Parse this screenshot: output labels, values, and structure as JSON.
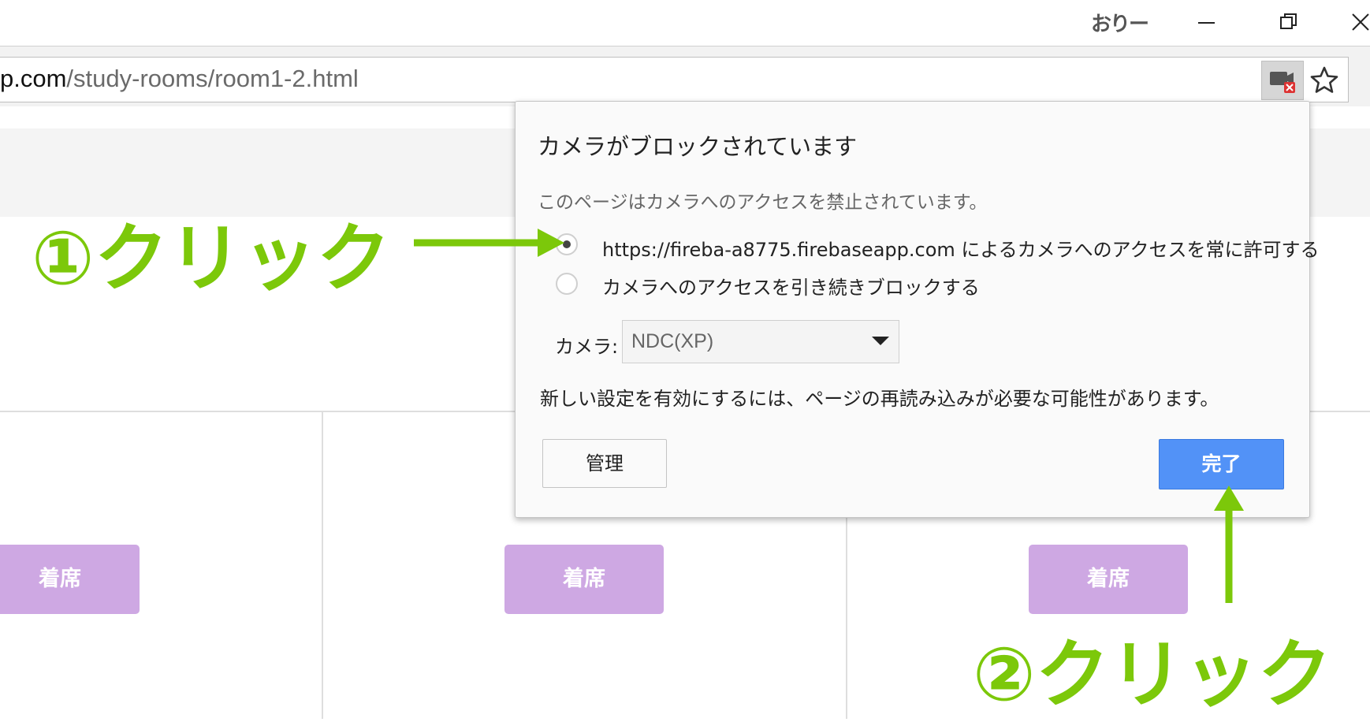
{
  "window": {
    "user_name": "おりー",
    "controls": [
      "minimize",
      "restore",
      "close"
    ]
  },
  "toolbar": {
    "url_host": "p.com",
    "url_path": "/study-rooms/room1-2.html",
    "camera_blocked_icon": "camera-blocked-icon",
    "bookmark_icon": "star-icon"
  },
  "page": {
    "seat_buttons": [
      "着席",
      "着席",
      "着席"
    ]
  },
  "permission_bubble": {
    "title": "カメラがブロックされています",
    "description": "このページはカメラへのアクセスを禁止されています。",
    "options": [
      {
        "label": "https://fireba-a8775.firebaseapp.com によるカメラへのアクセスを常に許可する",
        "checked": true
      },
      {
        "label": "カメラへのアクセスを引き続きブロックする",
        "checked": false
      }
    ],
    "camera_label": "カメラ:",
    "camera_selected": "NDC(XP)",
    "reload_note": "新しい設定を有効にするには、ページの再読み込みが必要な可能性があります。",
    "manage_label": "管理",
    "done_label": "完了"
  },
  "annotations": {
    "step1": "①クリック",
    "step2": "②クリック"
  },
  "colors": {
    "annotation_green": "#7cc80a",
    "seat_button": "#cea8e3",
    "done_button": "#5292f7"
  }
}
